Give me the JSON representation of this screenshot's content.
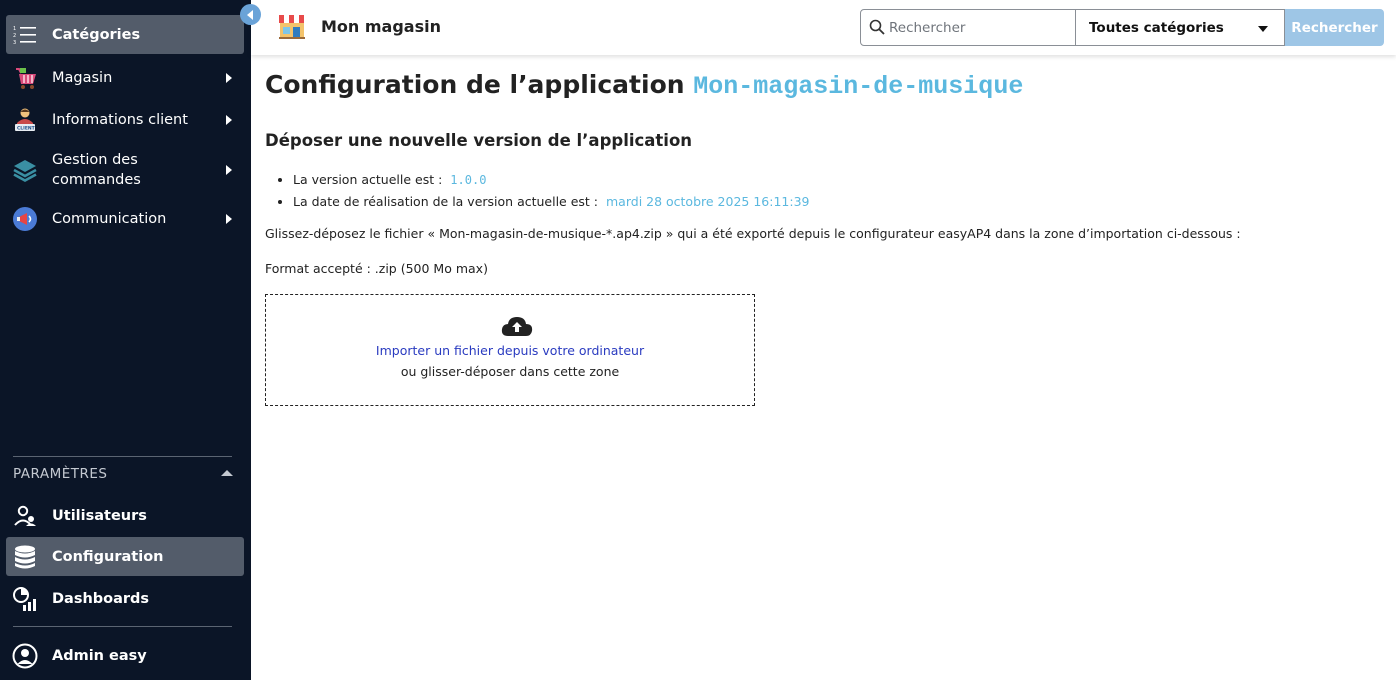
{
  "sidebar": {
    "top_items": [
      {
        "label": "Catégories",
        "icon": "list-icon"
      },
      {
        "label": "Magasin",
        "icon": "shopping-basket-icon"
      },
      {
        "label": "Informations client",
        "icon": "client-icon"
      },
      {
        "label": "Gestion des commandes",
        "icon": "layers-icon"
      },
      {
        "label": "Communication",
        "icon": "megaphone-icon"
      }
    ],
    "section_title": "PARAMÈTRES",
    "settings_items": [
      {
        "label": "Utilisateurs",
        "icon": "users-icon"
      },
      {
        "label": "Configuration",
        "icon": "database-icon"
      },
      {
        "label": "Dashboards",
        "icon": "dashboard-icon"
      }
    ],
    "user": {
      "label": "Admin easy",
      "icon": "user-circle-icon"
    }
  },
  "header": {
    "app_name": "Mon magasin",
    "search_placeholder": "Rechercher",
    "category_select": "Toutes catégories",
    "search_button": "Rechercher"
  },
  "main": {
    "title": "Configuration de l’application",
    "app_id": "Mon-magasin-de-musique",
    "subtitle": "Déposer une nouvelle version de l’application",
    "info": [
      {
        "label": "La version actuelle est :",
        "value": "1.0.0"
      },
      {
        "label": "La date de réalisation de la version actuelle est :",
        "value": "mardi 28 octobre 2025 16:11:39"
      }
    ],
    "instructions": "Glissez-déposez le fichier « Mon-magasin-de-musique-*.ap4.zip » qui a été exporté depuis le configurateur easyAP4 dans la zone d’importation ci-dessous :",
    "format": "Format accepté : .zip (500 Mo max)",
    "dropzone": {
      "link": "Importer un fichier depuis votre ordinateur",
      "text": "ou glisser-déposer dans cette zone"
    }
  },
  "colors": {
    "sidebar_bg": "#0b1527",
    "active_item_bg": "#535c6a",
    "accent": "#5bb8df",
    "search_button": "#9ec6e6",
    "link": "#2a3bc0"
  }
}
